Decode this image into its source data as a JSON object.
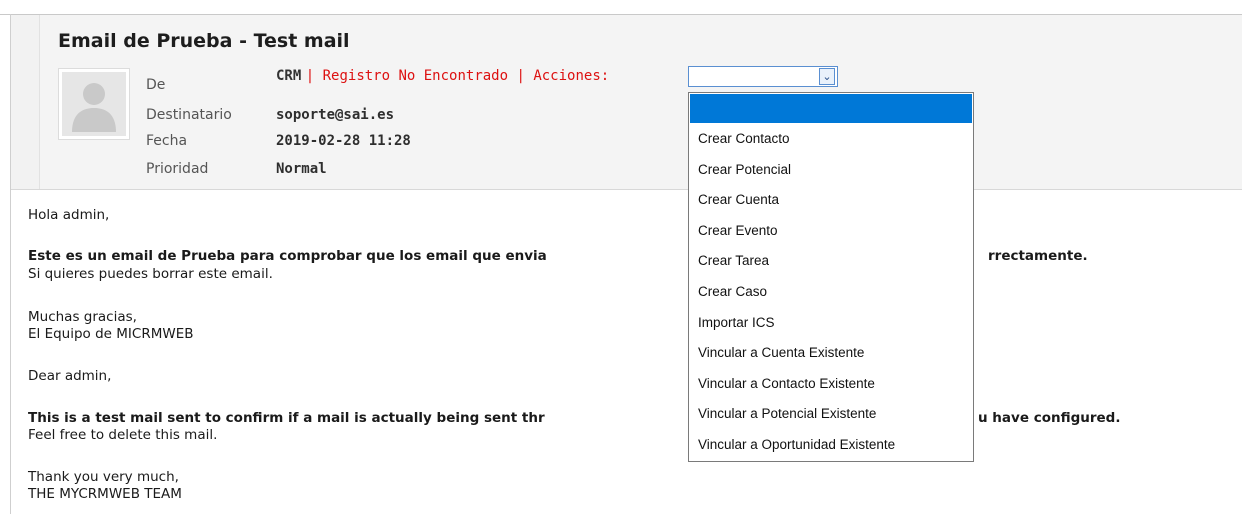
{
  "email": {
    "subject": "Email de Prueba - Test mail",
    "labels": {
      "from": "De",
      "to": "Destinatario",
      "date": "Fecha",
      "priority": "Prioridad"
    },
    "from_sender": "CRM",
    "from_status": "| Registro No Encontrado | Acciones:",
    "to": "soporte@sai.es",
    "date": "2019-02-28 11:28",
    "priority": "Normal"
  },
  "actions_select": {
    "selected": "",
    "options": [
      "",
      "Crear Contacto",
      "Crear Potencial",
      "Crear Cuenta",
      "Crear Evento",
      "Crear Tarea",
      "Crear Caso",
      "Importar ICS",
      "Vincular a Cuenta Existente",
      "Vincular a Contacto Existente",
      "Vincular a Potencial Existente",
      "Vincular a Oportunidad Existente"
    ]
  },
  "body": {
    "greeting_es": "Hola admin,",
    "bold_es_left": "Este es un email de Prueba para comprobar que los email que envia",
    "bold_es_right": "rrectamente.",
    "line_es": "Si quieres puedes borrar este email.",
    "thanks_es": "Muchas gracias,",
    "team_es": "El Equipo de MICRMWEB",
    "greeting_en": "Dear admin,",
    "bold_en_left": "This is a test mail sent to confirm if a mail is actually being sent thr",
    "bold_en_right": "u have configured.",
    "line_en": "Feel free to delete this mail.",
    "thanks_en": "Thank you very much,",
    "team_en": "THE MYCRMWEB TEAM"
  },
  "colors": {
    "accent": "#0078d7",
    "status_red": "#d11111",
    "header_bg": "#f4f4f4"
  }
}
